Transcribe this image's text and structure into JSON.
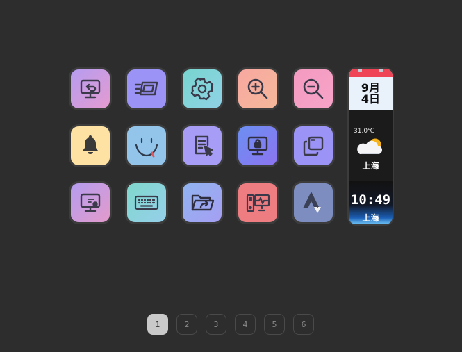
{
  "tiles": [
    {
      "icon": "monitor-restore-icon",
      "action": "monitor-restore"
    },
    {
      "icon": "screen-motion-icon",
      "action": "screen-motion"
    },
    {
      "icon": "gear-icon",
      "action": "settings"
    },
    {
      "icon": "zoom-in-icon",
      "action": "zoom-in"
    },
    {
      "icon": "zoom-out-icon",
      "action": "zoom-out"
    },
    {
      "icon": "bell-icon",
      "action": "notifications"
    },
    {
      "icon": "smiley-face-icon",
      "action": "emoji"
    },
    {
      "icon": "document-cursor-icon",
      "action": "select-document"
    },
    {
      "icon": "monitor-lock-icon",
      "action": "lock-screen"
    },
    {
      "icon": "window-copy-icon",
      "action": "duplicate-window"
    },
    {
      "icon": "monitor-settings-icon",
      "action": "display-settings"
    },
    {
      "icon": "keyboard-icon",
      "action": "keyboard"
    },
    {
      "icon": "folder-open-share-icon",
      "action": "open-folder"
    },
    {
      "icon": "pc-monitor-activity-icon",
      "action": "system-monitor"
    },
    {
      "icon": "strava-logo-icon",
      "action": "strava"
    }
  ],
  "widget": {
    "calendar": {
      "month": "9月",
      "day": "4日"
    },
    "weather": {
      "temperature": "31.0℃",
      "icon": "partly-cloudy-icon",
      "city": "上海"
    },
    "clock": {
      "time": "10:49",
      "city": "上海"
    }
  },
  "pager": {
    "pages": [
      "1",
      "2",
      "3",
      "4",
      "5",
      "6"
    ],
    "active": "1"
  }
}
